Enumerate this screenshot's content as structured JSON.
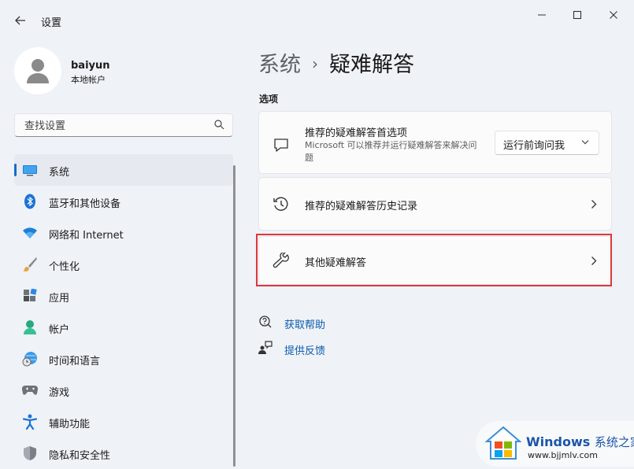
{
  "window": {
    "title": "设置"
  },
  "profile": {
    "name": "baiyun",
    "account_type": "本地帐户"
  },
  "search": {
    "placeholder": "查找设置"
  },
  "sidebar": {
    "items": [
      {
        "label": "系统",
        "icon": "monitor-icon",
        "active": true
      },
      {
        "label": "蓝牙和其他设备",
        "icon": "bluetooth-icon"
      },
      {
        "label": "网络和 Internet",
        "icon": "wifi-icon"
      },
      {
        "label": "个性化",
        "icon": "brush-icon"
      },
      {
        "label": "应用",
        "icon": "apps-icon"
      },
      {
        "label": "帐户",
        "icon": "account-icon"
      },
      {
        "label": "时间和语言",
        "icon": "globe-clock-icon"
      },
      {
        "label": "游戏",
        "icon": "gamepad-icon"
      },
      {
        "label": "辅助功能",
        "icon": "accessibility-icon"
      },
      {
        "label": "隐私和安全性",
        "icon": "shield-icon"
      }
    ]
  },
  "breadcrumb": {
    "parent": "系统",
    "separator": "›",
    "current": "疑难解答"
  },
  "section_title": "选项",
  "cards": {
    "recommended_prefs": {
      "title": "推荐的疑难解答首选项",
      "description": "Microsoft 可以推荐并运行疑难解答来解决问题",
      "dropdown_value": "运行前询问我"
    },
    "history": {
      "title": "推荐的疑难解答历史记录"
    },
    "other": {
      "title": "其他疑难解答"
    }
  },
  "links": {
    "help": "获取帮助",
    "feedback": "提供反馈"
  },
  "watermark": {
    "title": "Windows",
    "title_cn": "系统之家",
    "url": "www.bjjmlv.com"
  },
  "colors": {
    "accent": "#1a6cc4",
    "link": "#0b5cad",
    "highlight": "#e0373a",
    "background": "#eff2f7"
  }
}
